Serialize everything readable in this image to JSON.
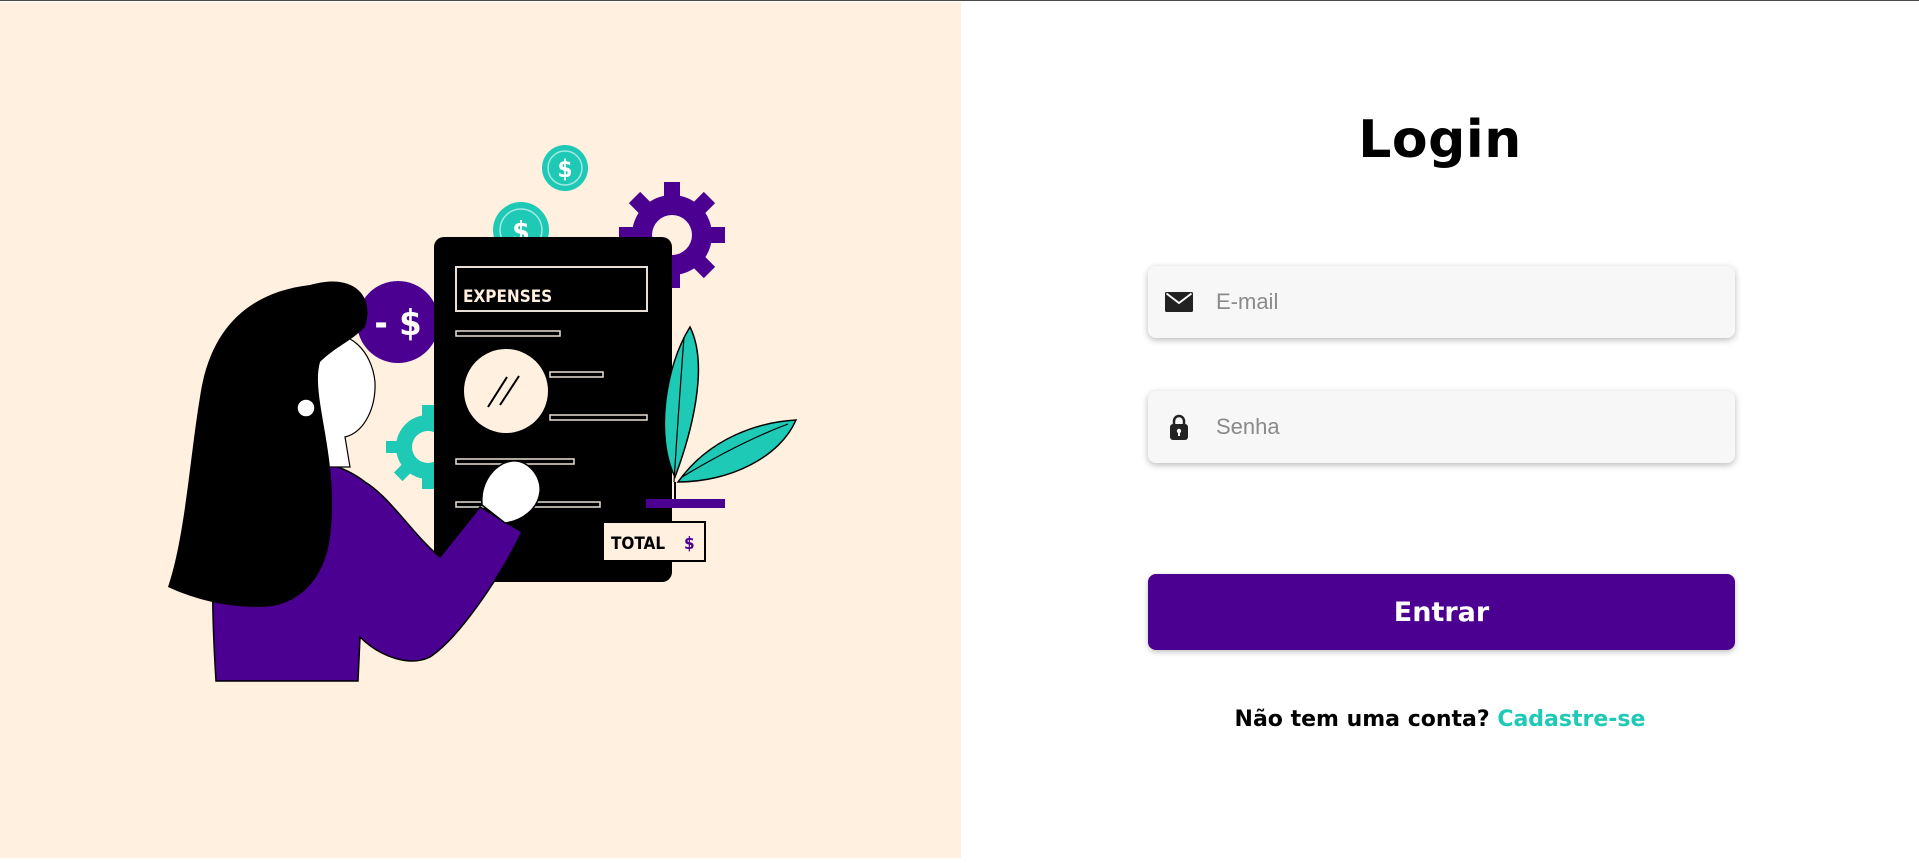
{
  "colors": {
    "left_background": "#fff0e0",
    "accent_purple": "#4b0092",
    "accent_teal": "#1ec9b5",
    "field_background": "#f7f7f7"
  },
  "illustration": {
    "document_heading": "EXPENSES",
    "total_label": "TOTAL",
    "coin_symbol": "$",
    "minus_badge": "- $"
  },
  "login": {
    "title": "Login",
    "email": {
      "icon": "envelope-icon",
      "placeholder": "E-mail",
      "value": ""
    },
    "password": {
      "icon": "lock-icon",
      "placeholder": "Senha",
      "value": ""
    },
    "submit_label": "Entrar",
    "signup_prompt": "Não tem uma conta?",
    "signup_link": "Cadastre-se"
  }
}
